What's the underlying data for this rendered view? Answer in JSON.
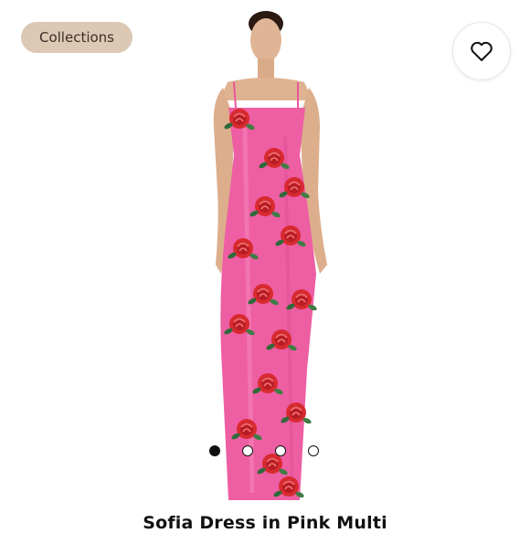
{
  "header": {
    "collections_label": "Collections"
  },
  "icons": {
    "favorite": "heart-outline-icon"
  },
  "product": {
    "title": "Sofia Dress in Pink Multi"
  },
  "gallery": {
    "total_images": 4,
    "active_index": 0
  },
  "colors": {
    "chip_bg": "#dcc8b4",
    "dress_pink": "#ee5ea3",
    "rose_red": "#d8282e"
  }
}
